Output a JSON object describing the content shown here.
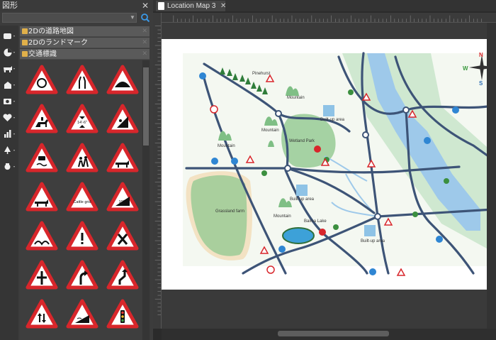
{
  "library": {
    "title": "図形",
    "close_label": "✕",
    "search": {
      "value": "",
      "placeholder": ""
    },
    "categories": [
      {
        "label": "2Dの道路地図"
      },
      {
        "label": "2Dのランドマーク"
      },
      {
        "label": "交通標識"
      }
    ],
    "tools": [
      "rectangle-tool",
      "pie-tool",
      "animal-tool",
      "building-tool",
      "camera-tool",
      "heart-tool",
      "chart-tool",
      "tree-tool",
      "vase-tool"
    ],
    "signs": [
      [
        "roundabout-sign",
        "road-narrows-sign",
        "hump-bridge-sign"
      ],
      [
        "horse-rider-sign",
        "height-limit-sign",
        "falling-rocks-sign"
      ],
      [
        "slippery-road-sign",
        "children-crossing-sign",
        "cattle-sign"
      ],
      [
        "cow-sign",
        "cattle-grid-sign",
        "steep-hill-sign"
      ],
      [
        "uneven-road-sign",
        "warning-sign",
        "crossroads-sign"
      ],
      [
        "junction-sign",
        "bend-right-sign",
        "double-bend-sign"
      ],
      [
        "two-way-traffic-sign",
        "quayside-sign",
        "traffic-signals-sign"
      ]
    ],
    "sign_texts": {
      "height": "14'-6\"",
      "grid": "Cattle grid",
      "hill": "10%"
    }
  },
  "document": {
    "tab_title": "Location Map 3",
    "tab_close": "✕"
  },
  "map": {
    "labels": {
      "pinehurst": "Pinehurst",
      "mountain1": "Mountain",
      "mountain2": "Mountain",
      "mountain3": "Mountain",
      "mountain4": "Mountain",
      "wetland": "Wetland Park",
      "builtup1": "Built-up area",
      "builtup2": "Built-up area",
      "builtup3": "Built-up area",
      "grassland": "Grassland farm",
      "baima": "Baima Lake"
    },
    "compass": {
      "n": "N",
      "w": "W",
      "s": "S"
    },
    "colors": {
      "road": "#3d5477",
      "river": "#9ec9ea",
      "green": "#9ccc9b",
      "grass": "#a9cf9d",
      "land": "#f5f9f2",
      "farm": "#f5e6c8"
    }
  }
}
